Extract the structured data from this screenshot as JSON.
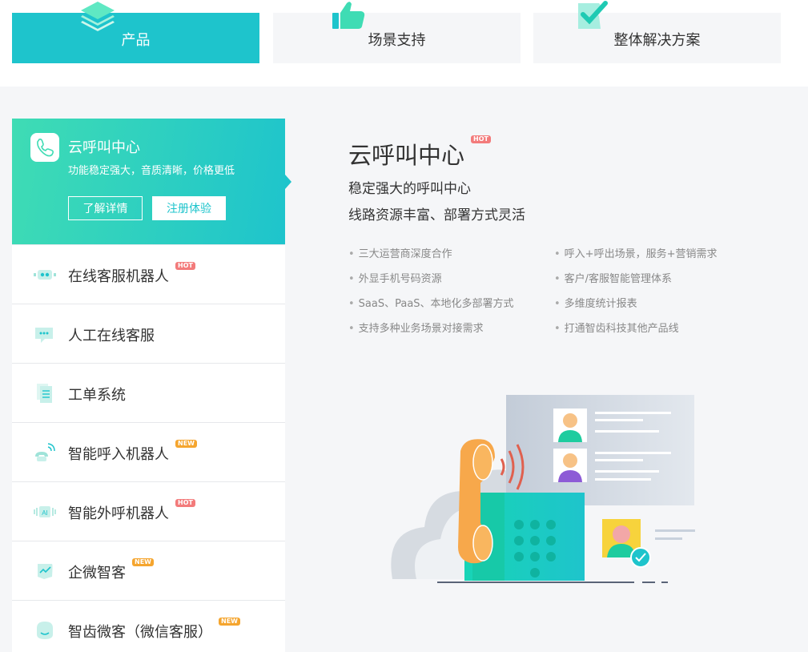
{
  "tabs": [
    {
      "label": "产品",
      "icon": "layers-icon",
      "active": true
    },
    {
      "label": "场景支持",
      "icon": "thumbs-up-icon",
      "active": false
    },
    {
      "label": "整体解决方案",
      "icon": "checkmark-icon",
      "active": false
    }
  ],
  "active_product": {
    "title": "云呼叫中心",
    "desc": "功能稳定强大，音质清晰，价格更低",
    "details_button": "了解详情",
    "trial_button": "注册体验",
    "icon": "phone-icon"
  },
  "menu": [
    {
      "label": "在线客服机器人",
      "tag": "HOT",
      "icon": "robot-icon"
    },
    {
      "label": "人工在线客服",
      "tag": "",
      "icon": "chat-bubble-icon"
    },
    {
      "label": "工单系统",
      "tag": "",
      "icon": "document-icon"
    },
    {
      "label": "智能呼入机器人",
      "tag": "NEW",
      "icon": "incoming-call-icon"
    },
    {
      "label": "智能外呼机器人",
      "tag": "HOT",
      "icon": "ai-voice-icon"
    },
    {
      "label": "企微智客",
      "tag": "NEW",
      "icon": "wecom-icon"
    },
    {
      "label": "智齿微客（微信客服）",
      "tag": "NEW",
      "icon": "wechat-service-icon"
    }
  ],
  "detail": {
    "title": "云呼叫中心",
    "tag": "HOT",
    "subtitle_1": "稳定强大的呼叫中心",
    "subtitle_2": "线路资源丰富、部署方式灵活",
    "features_left": [
      "三大运营商深度合作",
      "外显手机号码资源",
      "SaaS、PaaS、本地化多部署方式",
      "支持多种业务场景对接需求"
    ],
    "features_right": [
      "呼入+呼出场景，服务+营销需求",
      "客户/客服智能管理体系",
      "多维度统计报表",
      "打通智齿科技其他产品线"
    ]
  },
  "colors": {
    "accent": "#1ec4cc",
    "accent_light": "#3fdcb4",
    "hot": "#f37b7b",
    "new": "#f5a52e"
  }
}
